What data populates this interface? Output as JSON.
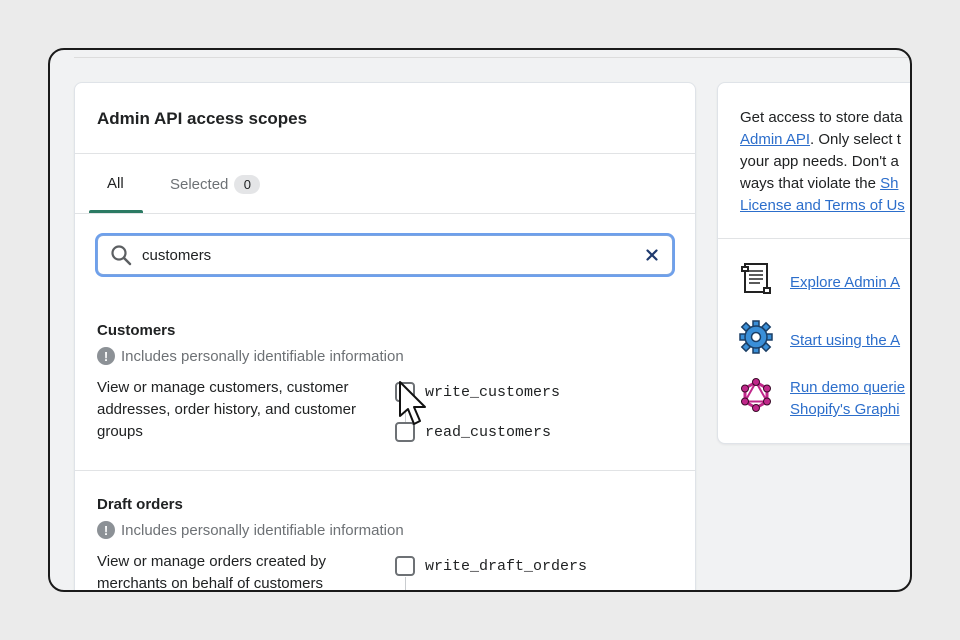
{
  "card": {
    "title": "Admin API access scopes",
    "tabs": [
      {
        "label": "All"
      },
      {
        "label": "Selected",
        "count": "0"
      }
    ],
    "search": {
      "value": "customers",
      "placeholder": ""
    }
  },
  "sections": [
    {
      "title": "Customers",
      "pii_note": "Includes personally identifiable information",
      "description": "View or manage customers, customer addresses, order history, and customer groups",
      "scopes": [
        "write_customers",
        "read_customers"
      ]
    },
    {
      "title": "Draft orders",
      "pii_note": "Includes personally identifiable information",
      "description": "View or manage orders created by merchants on behalf of customers",
      "scopes": [
        "write_draft_orders"
      ]
    }
  ],
  "side": {
    "intro_before": "Get access to store data",
    "intro_link1": "Admin API",
    "intro_mid": ". Only select t",
    "intro_line3": "your app needs. Don't a",
    "intro_line4": "ways that violate the ",
    "intro_link2a": "Sh",
    "intro_link2b": "License and Terms of Us",
    "resources": [
      {
        "icon": "scroll-icon",
        "label": "Explore Admin A"
      },
      {
        "icon": "gear-icon",
        "label": "Start using the A"
      },
      {
        "icon": "graphql-icon",
        "label_line1": "Run demo querie",
        "label_line2": "Shopify's Graphi"
      }
    ]
  },
  "colors": {
    "accent_tab": "#2b7a63",
    "focus_ring": "#6ea0ec",
    "link": "#2c6ecb",
    "gear": "#3a8fd8",
    "graphql": "#c0288a"
  }
}
